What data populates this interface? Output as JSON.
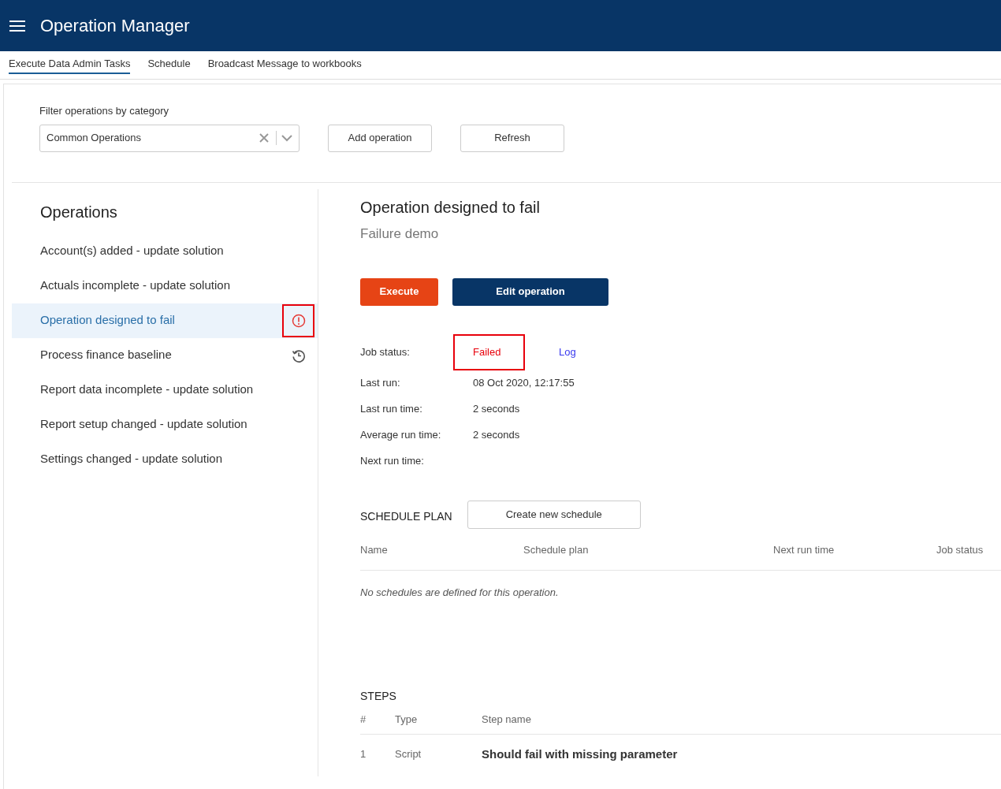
{
  "app_bar": {
    "title": "Operation Manager"
  },
  "tabs": [
    {
      "label": "Execute Data Admin Tasks",
      "selected": true
    },
    {
      "label": "Schedule",
      "selected": false
    },
    {
      "label": "Broadcast Message to workbooks",
      "selected": false
    }
  ],
  "filter": {
    "label": "Filter operations by category",
    "value": "Common Operations"
  },
  "toolbar_buttons": [
    "Add operation",
    "Refresh"
  ],
  "operations": {
    "title": "Operations",
    "items": [
      {
        "label": "Account(s) added - update solution",
        "selected": false,
        "kind": "plain",
        "highlighted": false
      },
      {
        "label": "Actuals incomplete - update solution",
        "selected": false,
        "kind": "plain",
        "highlighted": false
      },
      {
        "label": "Operation designed to fail",
        "selected": true,
        "kind": "failed",
        "highlighted": true
      },
      {
        "label": "Process finance baseline",
        "selected": false,
        "kind": "scheduled",
        "highlighted": false
      },
      {
        "label": "Report data incomplete - update solution",
        "selected": false,
        "kind": "plain",
        "highlighted": false
      },
      {
        "label": "Report setup changed - update solution",
        "selected": false,
        "kind": "plain",
        "highlighted": false
      },
      {
        "label": "Settings changed - update solution",
        "selected": false,
        "kind": "plain",
        "highlighted": false
      }
    ]
  },
  "detail": {
    "title": "Operation designed to fail",
    "subtitle": "Failure demo",
    "buttons": [
      {
        "label": "Execute",
        "kind": "primary"
      },
      {
        "label": "Edit operation",
        "kind": "secondary"
      }
    ],
    "job_status": {
      "label": "Job status:",
      "value": "Failed",
      "highlighted": true,
      "link": "Log"
    },
    "fields": [
      {
        "label": "Last run:",
        "value": "08 Oct 2020, 12:17:55"
      },
      {
        "label": "Last run time:",
        "value": "2 seconds"
      },
      {
        "label": "Average run time:",
        "value": "2 seconds"
      },
      {
        "label": "Next run time:"
      }
    ]
  },
  "schedule_plan": {
    "title": "SCHEDULE PLAN",
    "button": "Create new schedule",
    "columns": [
      "Name",
      "Schedule plan",
      "Next run time",
      "Job status"
    ],
    "empty_message": "No schedules are defined for this operation."
  },
  "steps": {
    "title": "STEPS",
    "columns": [
      "#",
      "Type",
      "Step name"
    ],
    "rows": [
      {
        "number": "1",
        "type": "Script",
        "name": "Should fail with missing parameter"
      }
    ]
  }
}
